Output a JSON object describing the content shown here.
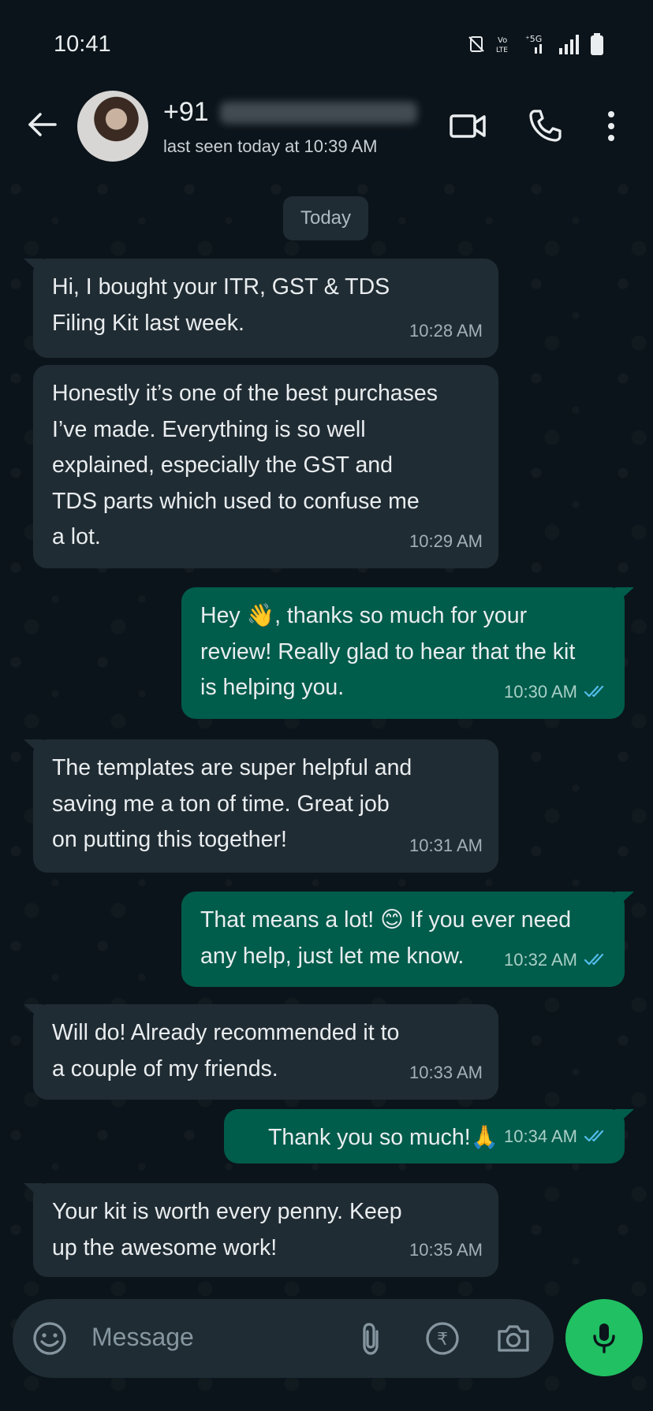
{
  "status_bar": {
    "time": "10:41",
    "icons": [
      "vibrate-mute-icon",
      "volte-icon",
      "5g-signal-icon",
      "signal-bars-icon",
      "battery-icon"
    ],
    "volte_label": "Vo LTE",
    "network_label": "5G"
  },
  "header": {
    "contact_prefix": "+91",
    "last_seen": "last seen today at 10:39 AM",
    "icons": [
      "back-arrow-icon",
      "video-call-icon",
      "voice-call-icon",
      "more-vert-icon"
    ]
  },
  "date_chip": "Today",
  "messages": [
    {
      "dir": "in",
      "text": "Hi, I bought your ITR, GST & TDS\nFiling Kit last week.",
      "time": "10:28 AM"
    },
    {
      "dir": "in",
      "text": "Honestly it’s one of the best purchases\nI’ve made. Everything is so well\nexplained, especially the GST and\nTDS parts which used to confuse me\na lot.",
      "time": "10:29 AM"
    },
    {
      "dir": "out",
      "text": "Hey 👋, thanks so much for your\nreview! Really glad to hear that the kit\nis helping you.",
      "time": "10:30 AM",
      "read": true
    },
    {
      "dir": "in",
      "text": "The templates are super helpful and\nsaving me a ton of time. Great job\non putting this together!",
      "time": "10:31 AM"
    },
    {
      "dir": "out",
      "text": "That means a lot! 😊 If you ever need\nany help, just let me know.",
      "time": "10:32 AM",
      "read": true
    },
    {
      "dir": "in",
      "text": "Will do! Already recommended it to\na couple of my friends.",
      "time": "10:33 AM"
    },
    {
      "dir": "out",
      "text": "Thank you so much!🙏",
      "time": "10:34 AM",
      "read": true
    },
    {
      "dir": "in",
      "text": "Your kit is worth every penny. Keep\nup the awesome work!",
      "time": "10:35 AM"
    }
  ],
  "composer": {
    "placeholder": "Message",
    "icons": [
      "emoji-icon",
      "attach-icon",
      "rupee-payment-icon",
      "camera-icon",
      "mic-icon"
    ]
  },
  "colors": {
    "background": "#0b141a",
    "incoming_bubble": "#202c33",
    "outgoing_bubble": "#005c4b",
    "read_ticks": "#53bdeb",
    "mic_button": "#21c063"
  }
}
